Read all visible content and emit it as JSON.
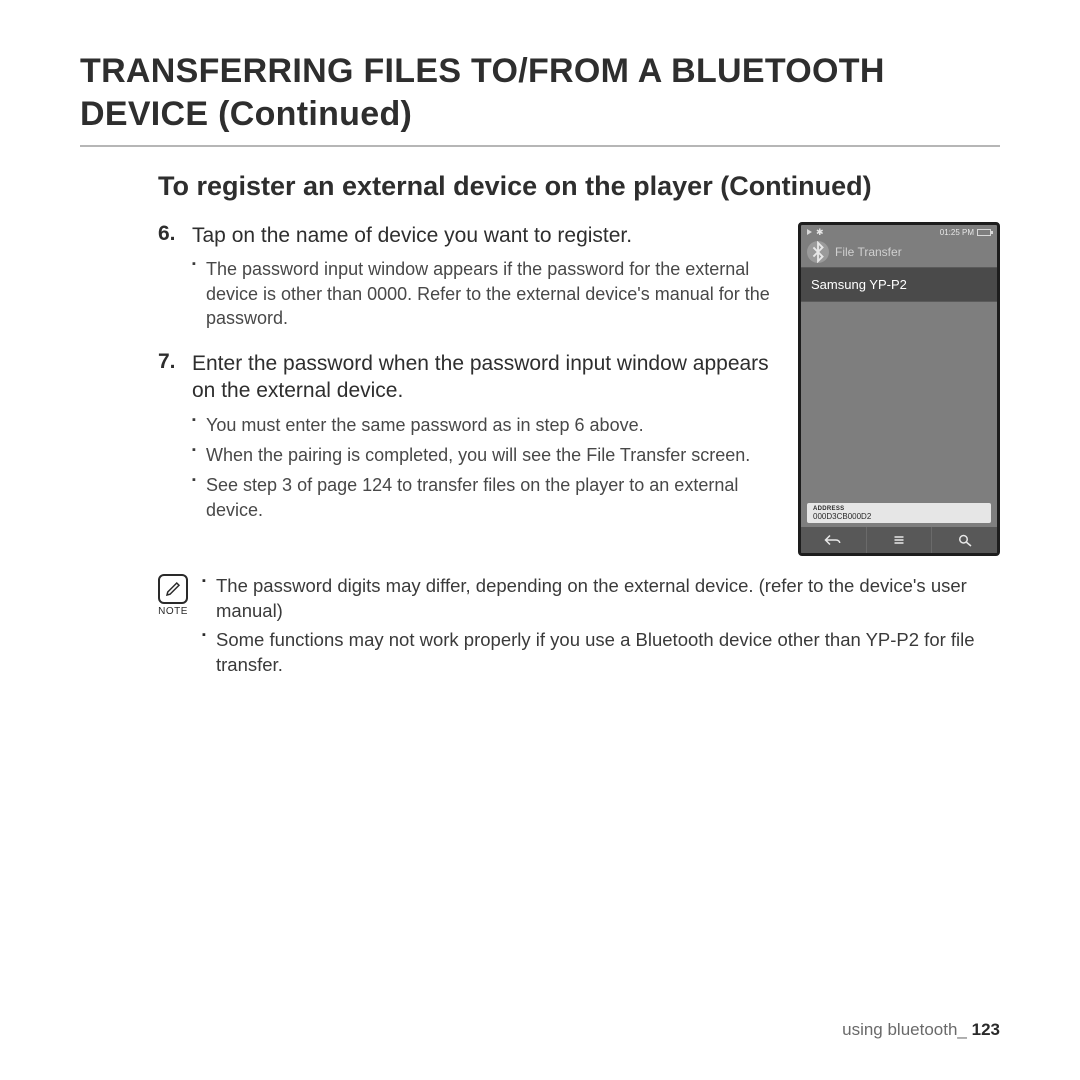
{
  "title": "TRANSFERRING FILES TO/FROM A BLUETOOTH DEVICE (Continued)",
  "section_heading": "To register an external device on the player (Continued)",
  "steps": [
    {
      "num": "6.",
      "title": "Tap on the name of device you want to register.",
      "bullets": [
        "The password input window appears if the password for the  external device is other than 0000. Refer to the external device's manual for the password."
      ]
    },
    {
      "num": "7.",
      "title": "Enter the password when the password input window appears on the external device.",
      "bullets": [
        "You must enter the same password as in step 6 above.",
        "When the pairing is completed, you will see the File Transfer screen.",
        "See step 3 of page 124 to transfer files on the player to an external device."
      ]
    }
  ],
  "note": {
    "label": "NOTE",
    "items": [
      "The password digits may differ, depending on the external device. (refer to the device's user manual)",
      "Some functions may not work properly if you use a Bluetooth device other than YP-P2 for file transfer."
    ]
  },
  "device": {
    "time": "01:25 PM",
    "header": "File Transfer",
    "list_item": "Samsung YP-P2",
    "address_label": "ADDRESS",
    "address_value": "000D3CB000D2"
  },
  "footer": {
    "section": "using bluetooth_",
    "page": "123"
  }
}
